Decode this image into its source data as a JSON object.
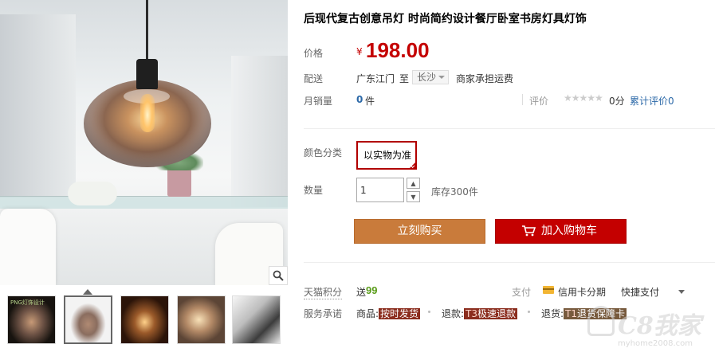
{
  "product": {
    "title": "后现代复古创意吊灯 时尚简约设计餐厅卧室书房灯具灯饰"
  },
  "gallery": {
    "zoom_icon": "magnifier-icon",
    "thumb1_label": "PNG灯饰设计"
  },
  "price": {
    "label": "价格",
    "currency": "¥",
    "value": "198.00"
  },
  "shipping": {
    "label": "配送",
    "from": "广东江门",
    "to_word": "至",
    "destination": "长沙",
    "fee": "商家承担运费"
  },
  "sales": {
    "label": "月销量",
    "count": "0",
    "unit": "件",
    "rating_label": "评价",
    "stars": "★★★★★",
    "rating_score": "0分",
    "review_link": "累计评价0"
  },
  "options": {
    "color_label": "颜色分类",
    "color_value": "以实物为准",
    "qty_label": "数量",
    "qty_value": "1",
    "qty_up": "▲",
    "qty_down": "▼",
    "stock": "库存300件"
  },
  "actions": {
    "buy_now": "立刻购买",
    "add_cart": "加入购物车"
  },
  "points": {
    "label": "天猫积分",
    "send": "送",
    "value": "99",
    "pay_label": "支付",
    "pay_credit": "信用卡分期",
    "pay_quick": "快捷支付"
  },
  "service": {
    "label": "服务承诺",
    "item1_prefix": "商品:",
    "item1_badge": "按时发货",
    "item2_prefix": "退款:",
    "item2_badge_t": "T3",
    "item2_badge": "极速退款",
    "item3_prefix": "退货:",
    "item3_badge_t": "T1",
    "item3_badge": "退货保障卡"
  },
  "watermark": {
    "text": "C8我家",
    "url": "myhome2008.com"
  },
  "colors": {
    "price_red": "#c40000",
    "buy_now_bg": "#c97b3b",
    "add_cart_bg": "#c40000",
    "link_blue": "#2c69a8",
    "points_green": "#5a9c1a"
  }
}
